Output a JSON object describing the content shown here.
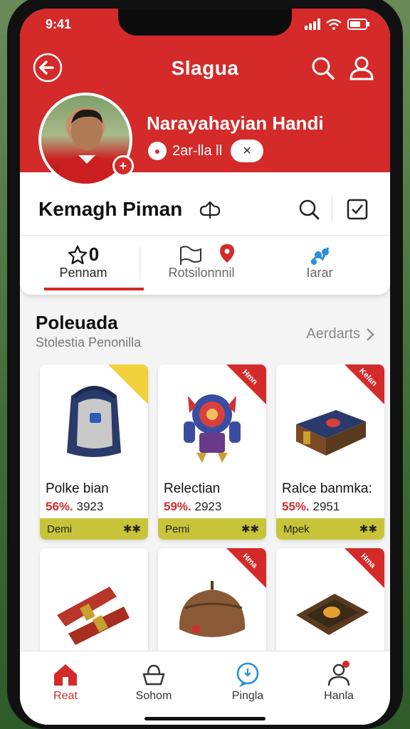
{
  "status": {
    "time": "9:41"
  },
  "colors": {
    "brand_red": "#d42a2a",
    "card_bar": "#c8c43a",
    "ribbon_yellow": "#f2d23a"
  },
  "header": {
    "app_title": "Slagua",
    "user_name": "Narayahayian Handi",
    "user_meta": "2ar-lla ll"
  },
  "profile": {
    "title": "Kemagh Piman",
    "stats": [
      {
        "value": "0",
        "label": "Pennam",
        "icon": "star-icon"
      },
      {
        "label": "Rotsilonnnil",
        "icon": "flag-icon"
      },
      {
        "label": "Iarar",
        "icon": "network-icon"
      }
    ]
  },
  "section": {
    "title": "Poleuada",
    "subtitle": "Stolestia Penonilla",
    "see_all": "Aerdarts"
  },
  "cards": [
    {
      "name": "Polke bian",
      "pct": "56%.",
      "price": "3923",
      "bar_label": "Demi",
      "ribbon": "",
      "ribbon_color": "#f2d23a",
      "image": "backpack"
    },
    {
      "name": "Relectian",
      "pct": "59%.",
      "price": "2923",
      "bar_label": "Pemi",
      "ribbon": "Hmn",
      "ribbon_color": "#d42a2a",
      "image": "robot"
    },
    {
      "name": "Ralce banmka:",
      "pct": "55%.",
      "price": "2951",
      "bar_label": "Mpek",
      "ribbon": "Kelan",
      "ribbon_color": "#d42a2a",
      "image": "chest"
    },
    {
      "name": "",
      "ribbon": "",
      "image": "scrolls"
    },
    {
      "name": "",
      "ribbon": "Hma",
      "ribbon_color": "#d42a2a",
      "image": "helmet"
    },
    {
      "name": "",
      "ribbon": "Hma",
      "ribbon_color": "#d42a2a",
      "image": "frame"
    }
  ],
  "tabbar": [
    {
      "label": "Reat",
      "icon": "home-icon",
      "active": true
    },
    {
      "label": "Sohom",
      "icon": "basket-icon",
      "active": false
    },
    {
      "label": "Pingla",
      "icon": "chat-icon",
      "active": false
    },
    {
      "label": "Hanla",
      "icon": "user-icon",
      "active": false
    }
  ]
}
